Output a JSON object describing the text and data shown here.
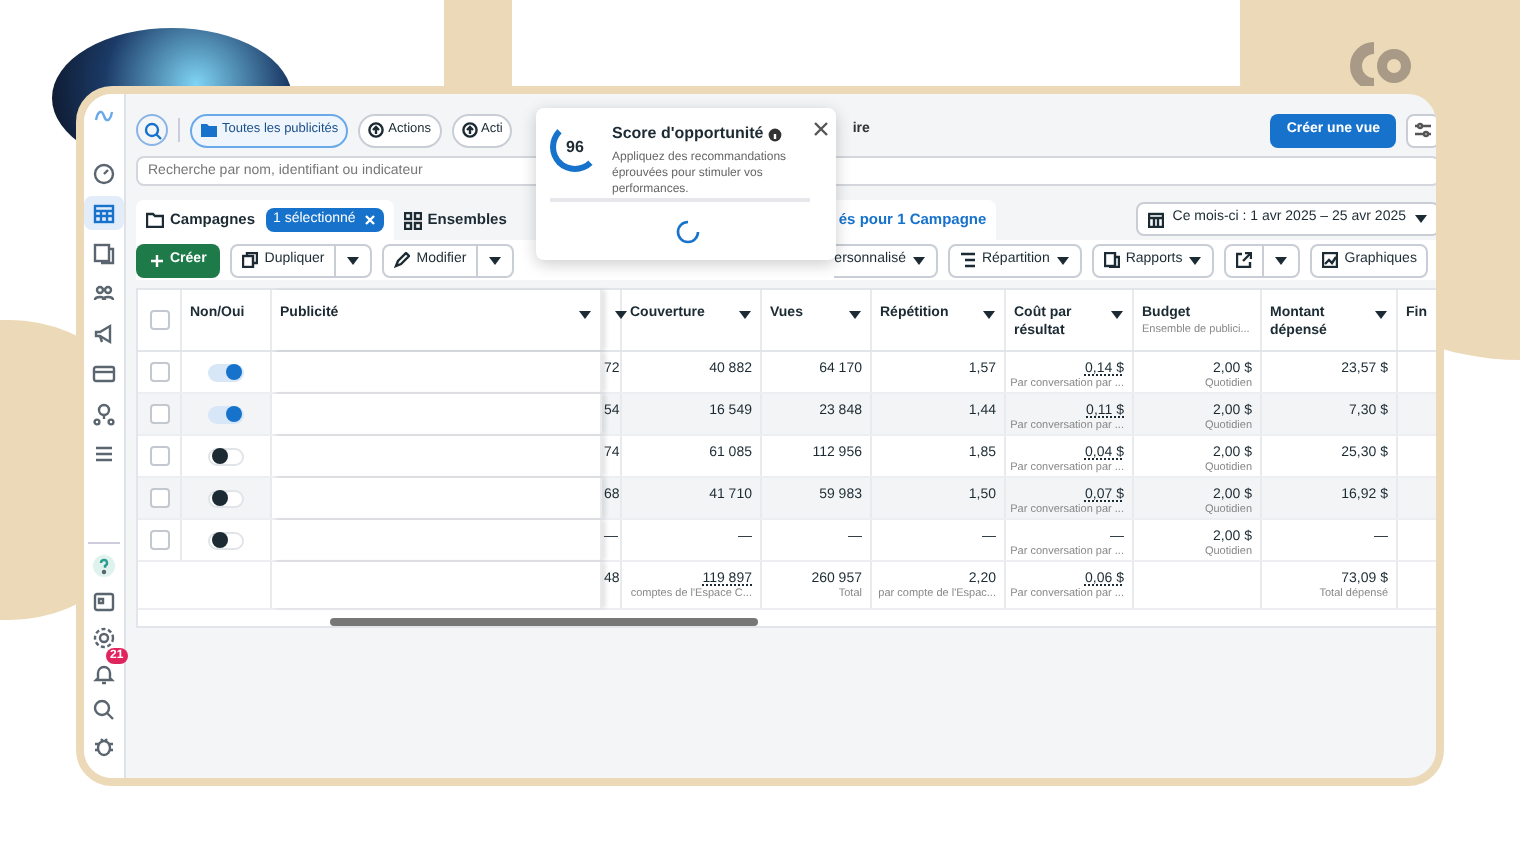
{
  "toolbar": {
    "filters": [
      {
        "label": "Toutes les publicités",
        "selected": true
      },
      {
        "label": "Actions",
        "selected": false
      },
      {
        "label": "Acti",
        "selected": false
      }
    ],
    "hidden_text": "ire",
    "create_view": "Créer une vue"
  },
  "search": {
    "placeholder": "Recherche par nom, identifiant ou indicateur"
  },
  "tabs": [
    {
      "label": "Campagnes",
      "badge": "1 sélectionné",
      "selected": false
    },
    {
      "label": "Ensembles",
      "selected": false
    },
    {
      "label": "és pour 1 Campagne",
      "selected": true
    }
  ],
  "date_range": "Ce mois-ci : 1 avr 2025 – 25 avr 2025",
  "actions": {
    "create": "Créer",
    "duplicate": "Dupliquer",
    "edit": "Modifier",
    "columns": "ersonnalisé",
    "breakdown": "Répartition",
    "reports": "Rapports",
    "charts": "Graphiques"
  },
  "sidebar": {
    "items": [
      {
        "selected": false
      },
      {
        "selected": true
      },
      {
        "selected": false
      },
      {
        "selected": false
      },
      {
        "selected": false
      },
      {
        "selected": false
      },
      {
        "selected": false
      },
      {
        "selected": false
      }
    ],
    "notification_badge": "21"
  },
  "popup": {
    "score": "96",
    "title": "Score d'opportunité",
    "text": "Appliquez des recommandations éprouvées pour stimuler vos performances."
  },
  "table": {
    "all_checked": false,
    "toggle_column": "Non/Oui",
    "name_column": "Publicité",
    "columns": [
      {
        "sortable": true
      },
      {
        "label": "Couverture",
        "sortable": true
      },
      {
        "label": "Vues",
        "sortable": true
      },
      {
        "label": "Répétition",
        "sortable": true
      },
      {
        "label": "Coût par résultat",
        "sortable": true
      },
      {
        "label": "Budget",
        "sub": "Ensemble de publici...",
        "sortable": false
      },
      {
        "label": "Montant dépensé",
        "sortable": true
      },
      {
        "label": "Fin",
        "sortable": false
      }
    ],
    "rows": [
      {
        "checked": false,
        "on": true,
        "cells": [
          {
            "value": "72"
          },
          {
            "value": "40 882"
          },
          {
            "value": "64 170"
          },
          {
            "value": "1,57"
          },
          {
            "value": "0,14 $",
            "sub": "Par conversation par ...",
            "link": true
          },
          {
            "value": "2,00 $",
            "sub": "Quotidien"
          },
          {
            "value": "23,57 $"
          }
        ]
      },
      {
        "checked": false,
        "on": true,
        "cells": [
          {
            "value": "54"
          },
          {
            "value": "16 549"
          },
          {
            "value": "23 848"
          },
          {
            "value": "1,44"
          },
          {
            "value": "0,11 $",
            "sub": "Par conversation par ...",
            "link": true
          },
          {
            "value": "2,00 $",
            "sub": "Quotidien"
          },
          {
            "value": "7,30 $"
          }
        ]
      },
      {
        "checked": false,
        "on": false,
        "cells": [
          {
            "value": "74"
          },
          {
            "value": "61 085"
          },
          {
            "value": "112 956"
          },
          {
            "value": "1,85"
          },
          {
            "value": "0,04 $",
            "sub": "Par conversation par ...",
            "link": true
          },
          {
            "value": "2,00 $",
            "sub": "Quotidien"
          },
          {
            "value": "25,30 $"
          }
        ]
      },
      {
        "checked": false,
        "on": false,
        "cells": [
          {
            "value": "68"
          },
          {
            "value": "41 710"
          },
          {
            "value": "59 983"
          },
          {
            "value": "1,50"
          },
          {
            "value": "0,07 $",
            "sub": "Par conversation par ...",
            "link": true
          },
          {
            "value": "2,00 $",
            "sub": "Quotidien"
          },
          {
            "value": "16,92 $"
          }
        ]
      },
      {
        "checked": false,
        "on": false,
        "cells": [
          {
            "value": "—"
          },
          {
            "value": "—"
          },
          {
            "value": "—"
          },
          {
            "value": "—"
          },
          {
            "value": "—",
            "sub": "Par conversation par ..."
          },
          {
            "value": "2,00 $",
            "sub": "Quotidien"
          },
          {
            "value": "—"
          }
        ]
      }
    ],
    "total": [
      {
        "value": "48"
      },
      {
        "value": "119 897",
        "sub": "comptes de l'Espace C...",
        "link": true
      },
      {
        "value": "260 957",
        "sub": "Total"
      },
      {
        "value": "2,20",
        "sub": "par compte de l'Espac..."
      },
      {
        "value": "0,06 $",
        "sub": "Par conversation par ...",
        "link": true
      },
      {
        "value": "73,09 $",
        "sub": "Total dépensé",
        "after_gap": true
      }
    ]
  }
}
